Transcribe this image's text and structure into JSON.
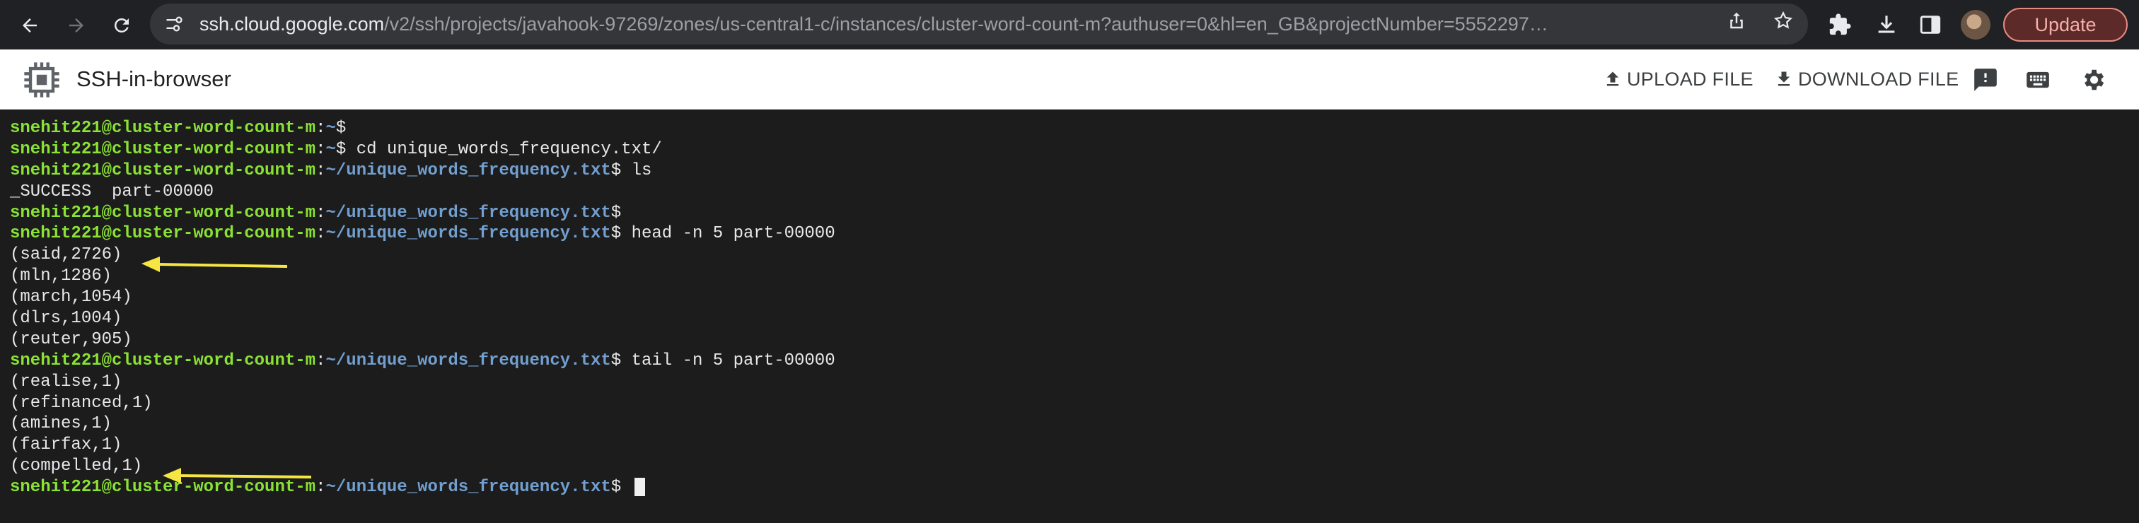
{
  "browser": {
    "url_host": "ssh.cloud.google.com",
    "url_path": "/v2/ssh/projects/javahook-97269/zones/us-central1-c/instances/cluster-word-count-m?authuser=0&hl=en_GB&projectNumber=5552297…",
    "update_label": "Update"
  },
  "app": {
    "title": "SSH-in-browser",
    "upload_label": "UPLOAD FILE",
    "download_label": "DOWNLOAD FILE"
  },
  "terminal": {
    "user": "snehit221@cluster-word-count-m",
    "lines": [
      {
        "type": "prompt",
        "path": "~",
        "cmd": ""
      },
      {
        "type": "prompt",
        "path": "~",
        "cmd": "cd unique_words_frequency.txt/"
      },
      {
        "type": "prompt",
        "path": "~/unique_words_frequency.txt",
        "cmd": "ls"
      },
      {
        "type": "output",
        "text": "_SUCCESS  part-00000"
      },
      {
        "type": "prompt",
        "path": "~/unique_words_frequency.txt",
        "cmd": ""
      },
      {
        "type": "prompt",
        "path": "~/unique_words_frequency.txt",
        "cmd": "head -n 5 part-00000"
      },
      {
        "type": "output",
        "text": "(said,2726)"
      },
      {
        "type": "output",
        "text": "(mln,1286)"
      },
      {
        "type": "output",
        "text": "(march,1054)"
      },
      {
        "type": "output",
        "text": "(dlrs,1004)"
      },
      {
        "type": "output",
        "text": "(reuter,905)"
      },
      {
        "type": "prompt",
        "path": "~/unique_words_frequency.txt",
        "cmd": "tail -n 5 part-00000"
      },
      {
        "type": "output",
        "text": "(realise,1)"
      },
      {
        "type": "output",
        "text": "(refinanced,1)"
      },
      {
        "type": "output",
        "text": "(amines,1)"
      },
      {
        "type": "output",
        "text": "(fairfax,1)"
      },
      {
        "type": "output",
        "text": "(compelled,1)"
      },
      {
        "type": "prompt",
        "path": "~/unique_words_frequency.txt",
        "cmd": "",
        "cursor": true
      }
    ]
  },
  "colors": {
    "prompt_user": "#8ae234",
    "prompt_path": "#729fcf",
    "arrow": "#f5e642",
    "terminal_bg": "#1c1c1c"
  }
}
